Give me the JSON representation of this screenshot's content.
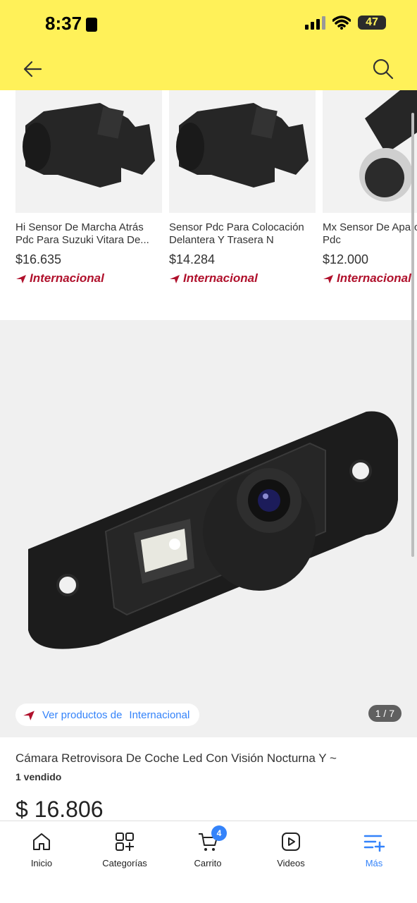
{
  "status": {
    "time": "8:37",
    "battery": "47"
  },
  "carousel": {
    "items": [
      {
        "title": "Hi Sensor De Marcha Atrás Pdc Para Suzuki Vitara De...",
        "price": "$16.635",
        "shipping": "Internacional"
      },
      {
        "title": "Sensor Pdc Para Colocación Delantera Y Trasera N",
        "price": "$14.284",
        "shipping": "Internacional"
      },
      {
        "title": "Mx Sensor De Aparcamiento Pdc",
        "price": "$12.000",
        "shipping": "Internacional"
      }
    ]
  },
  "gallery": {
    "intl_link_prefix": "Ver productos de",
    "intl_link_strong": "Internacional",
    "counter": "1 / 7"
  },
  "product": {
    "title": "Cámara Retrovisora De Coche Led Con Visión Nocturna Y ~",
    "sold": "1 vendido",
    "price": "$ 16.806"
  },
  "tabbar": {
    "items": [
      {
        "label": "Inicio",
        "icon": "home-icon"
      },
      {
        "label": "Categorías",
        "icon": "categories-icon"
      },
      {
        "label": "Carrito",
        "icon": "cart-icon",
        "badge": "4"
      },
      {
        "label": "Videos",
        "icon": "video-icon"
      },
      {
        "label": "Más",
        "icon": "menu-plus-icon",
        "active": true
      }
    ]
  },
  "colors": {
    "brand_yellow": "#fff159",
    "accent_blue": "#3483fa",
    "international_red": "#b0112c"
  }
}
